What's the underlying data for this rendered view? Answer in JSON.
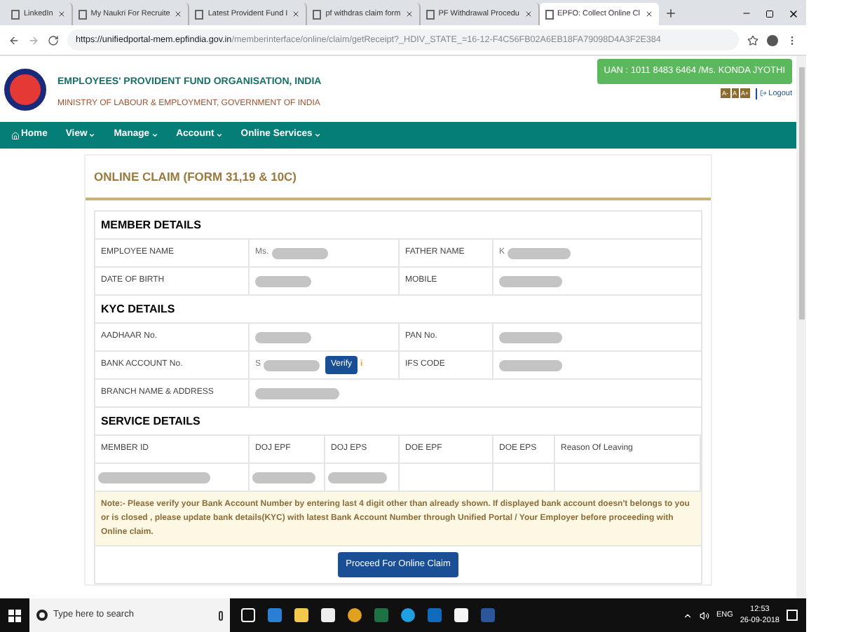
{
  "browser": {
    "tabs": [
      {
        "title": "LinkedIn",
        "selected": false
      },
      {
        "title": "My Naukri For Recruite",
        "selected": false
      },
      {
        "title": "Latest Provident Fund I",
        "selected": false
      },
      {
        "title": "pf withdras claim form",
        "selected": false
      },
      {
        "title": "PF Withdrawal Procedu",
        "selected": false
      },
      {
        "title": "EPFO: Collect Online Cl",
        "selected": true
      }
    ],
    "url": {
      "host": "https://unifiedportal-mem.epfindia.gov.in",
      "path": "/memberinterface/online/claim/getReceipt?_HDIV_STATE_=16-12-F4C56FB02A6EB18FA79098D4A3F2E384"
    }
  },
  "header": {
    "org_name": "EMPLOYEES' PROVIDENT FUND ORGANISATION, INDIA",
    "ministry": "MINISTRY OF LABOUR & EMPLOYMENT, GOVERNMENT OF INDIA",
    "uan": "UAN : 1011 8483 6464 /Ms. KONDA JYOTHI",
    "font_sizes": [
      "A-",
      "A",
      "A+"
    ],
    "logout": "Logout"
  },
  "nav": [
    {
      "label": "Home",
      "kind": "home"
    },
    {
      "label": "View",
      "kind": "menu"
    },
    {
      "label": "Manage",
      "kind": "menu"
    },
    {
      "label": "Account",
      "kind": "menu"
    },
    {
      "label": "Online Services",
      "kind": "menu"
    }
  ],
  "claim": {
    "title": "ONLINE CLAIM (FORM 31,19 & 10C)",
    "member_details": {
      "heading": "MEMBER DETAILS",
      "rows": [
        {
          "label_1": "EMPLOYEE NAME",
          "value_1": {
            "prefix": "Ms.",
            "redacted": true
          },
          "label_2": "FATHER NAME",
          "value_2": {
            "prefix": "K",
            "redacted": true
          }
        },
        {
          "label_1": "DATE OF BIRTH",
          "value_1": {
            "redacted": true
          },
          "label_2": "MOBILE",
          "value_2": {
            "redacted": true
          }
        }
      ]
    },
    "kyc_details": {
      "heading": "KYC DETAILS",
      "rows": [
        {
          "label_1": "AADHAAR No.",
          "value_1": {
            "redacted": true
          },
          "label_2": "PAN No.",
          "value_2": {
            "redacted": true
          }
        },
        {
          "label_1": "BANK ACCOUNT No.",
          "value_1": {
            "prefix": "S",
            "redacted": true,
            "button": "Verify",
            "info": "i"
          },
          "label_2": "IFS CODE",
          "value_2": {
            "redacted": true
          }
        }
      ],
      "branch": {
        "label": "BRANCH NAME & ADDRESS",
        "value": {
          "redacted": true
        }
      }
    },
    "service_details": {
      "heading": "SERVICE DETAILS",
      "columns": [
        "MEMBER ID",
        "DOJ EPF",
        "DOJ EPS",
        "DOE EPF",
        "DOE EPS",
        "Reason Of Leaving"
      ],
      "rows": [
        [
          {
            "redacted": true
          },
          {
            "redacted": true
          },
          {
            "redacted": true
          },
          {
            "redacted": false
          },
          {
            "redacted": false
          },
          {
            "redacted": false
          }
        ]
      ]
    },
    "note": "Note:- Please verify your Bank Account Number by entering last 4 digit other than already shown. If displayed bank account doesn't belongs to you or is closed , please update bank details(KYC) with latest Bank Account Number through Unified Portal / Your Employer before proceeding with Online claim.",
    "proceed_button": "Proceed For Online Claim"
  },
  "taskbar": {
    "search_placeholder": "Type here to search",
    "language": "ENG",
    "time": "12:53",
    "date": "26-09-2018"
  }
}
